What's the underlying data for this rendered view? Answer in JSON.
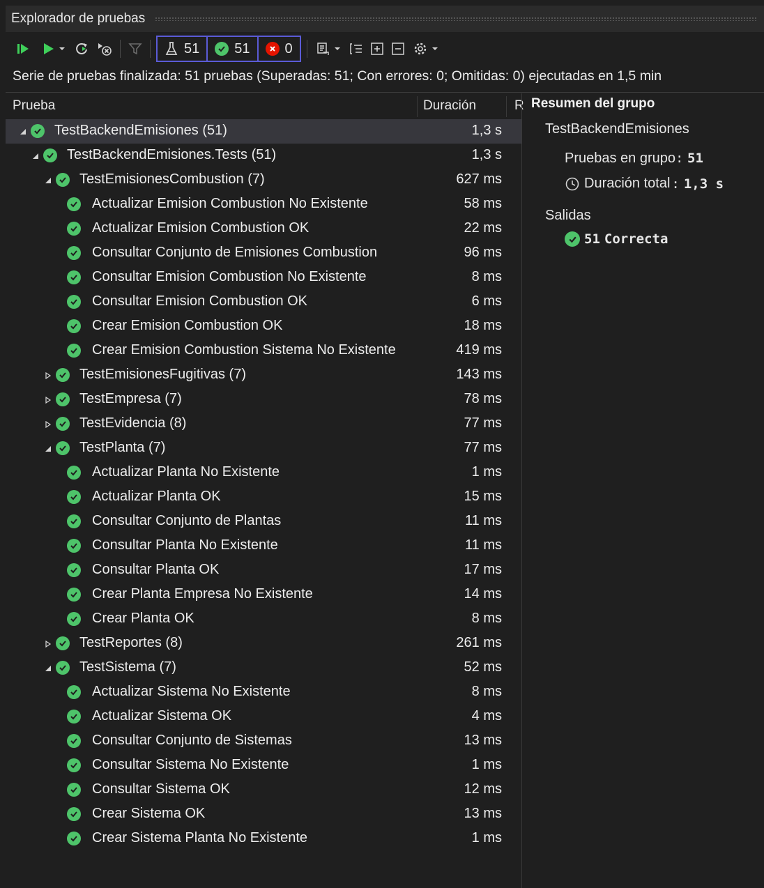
{
  "window": {
    "title": "Explorador de pruebas"
  },
  "toolbar": {
    "counters": [
      {
        "icon": "flask-icon",
        "value": "51"
      },
      {
        "icon": "passed-icon",
        "value": "51"
      },
      {
        "icon": "failed-icon",
        "value": "0"
      }
    ]
  },
  "status": "Serie de pruebas finalizada: 51 pruebas (Superadas: 51; Con errores: 0; Omitidas: 0) ejecutadas en 1,5 min",
  "columns": {
    "test": "Prueba",
    "duration": "Duración",
    "truncated": "R"
  },
  "tree": [
    {
      "name": "TestBackendEmisiones",
      "count": "(51)",
      "duration": "1,3 s",
      "level": 0,
      "expanded": true,
      "selected": true
    },
    {
      "name": "TestBackendEmisiones.Tests",
      "count": "(51)",
      "duration": "1,3 s",
      "level": 1,
      "expanded": true
    },
    {
      "name": "TestEmisionesCombustion",
      "count": "(7)",
      "duration": "627 ms",
      "level": 2,
      "expanded": true
    },
    {
      "name": "Actualizar Emision Combustion No Existente",
      "duration": "58 ms",
      "level": 3
    },
    {
      "name": "Actualizar Emision Combustion OK",
      "duration": "22 ms",
      "level": 3
    },
    {
      "name": "Consultar Conjunto de Emisiones Combustion",
      "duration": "96 ms",
      "level": 3
    },
    {
      "name": "Consultar Emision Combustion No Existente",
      "duration": "8 ms",
      "level": 3
    },
    {
      "name": "Consultar Emision Combustion OK",
      "duration": "6 ms",
      "level": 3
    },
    {
      "name": "Crear Emision Combustion OK",
      "duration": "18 ms",
      "level": 3
    },
    {
      "name": "Crear Emision Combustion Sistema No Existente",
      "duration": "419 ms",
      "level": 3
    },
    {
      "name": "TestEmisionesFugitivas",
      "count": "(7)",
      "duration": "143 ms",
      "level": 2,
      "expanded": false
    },
    {
      "name": "TestEmpresa",
      "count": "(7)",
      "duration": "78 ms",
      "level": 2,
      "expanded": false
    },
    {
      "name": "TestEvidencia",
      "count": "(8)",
      "duration": "77 ms",
      "level": 2,
      "expanded": false
    },
    {
      "name": "TestPlanta",
      "count": "(7)",
      "duration": "77 ms",
      "level": 2,
      "expanded": true
    },
    {
      "name": "Actualizar Planta No Existente",
      "duration": "1 ms",
      "level": 3
    },
    {
      "name": "Actualizar Planta OK",
      "duration": "15 ms",
      "level": 3
    },
    {
      "name": "Consultar Conjunto de Plantas",
      "duration": "11 ms",
      "level": 3
    },
    {
      "name": "Consultar Planta No Existente",
      "duration": "11 ms",
      "level": 3
    },
    {
      "name": "Consultar Planta OK",
      "duration": "17 ms",
      "level": 3
    },
    {
      "name": "Crear Planta Empresa No Existente",
      "duration": "14 ms",
      "level": 3
    },
    {
      "name": "Crear Planta OK",
      "duration": "8 ms",
      "level": 3
    },
    {
      "name": "TestReportes",
      "count": "(8)",
      "duration": "261 ms",
      "level": 2,
      "expanded": false
    },
    {
      "name": "TestSistema",
      "count": "(7)",
      "duration": "52 ms",
      "level": 2,
      "expanded": true
    },
    {
      "name": "Actualizar Sistema No Existente",
      "duration": "8 ms",
      "level": 3
    },
    {
      "name": "Actualizar Sistema OK",
      "duration": "4 ms",
      "level": 3
    },
    {
      "name": "Consultar Conjunto de Sistemas",
      "duration": "13 ms",
      "level": 3
    },
    {
      "name": "Consultar Sistema No Existente",
      "duration": "1 ms",
      "level": 3
    },
    {
      "name": "Consultar Sistema OK",
      "duration": "12 ms",
      "level": 3
    },
    {
      "name": "Crear Sistema OK",
      "duration": "13 ms",
      "level": 3
    },
    {
      "name": "Crear Sistema Planta No Existente",
      "duration": "1 ms",
      "level": 3
    }
  ],
  "details": {
    "heading": "Resumen del grupo",
    "group": "TestBackendEmisiones",
    "tests_label": "Pruebas en grupo",
    "tests_value": "51",
    "duration_label": "Duración total",
    "duration_value": "1,3 s",
    "outputs_heading": "Salidas",
    "outputs_count": "51",
    "outputs_status": "Correcta"
  },
  "colors": {
    "pass": "#4ec46a",
    "fail": "#e51400",
    "counter_border": "#5b5bd6",
    "run": "#3fcf5a"
  }
}
